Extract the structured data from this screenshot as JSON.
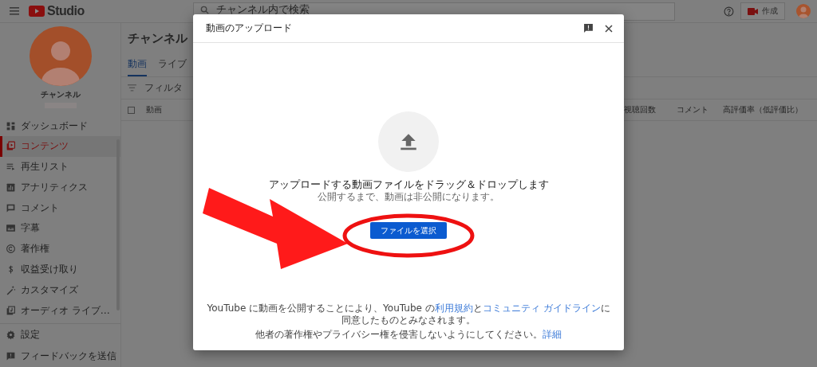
{
  "top_bar": {
    "logo_text": "Studio",
    "search": {
      "placeholder": "チャンネル内で検索"
    },
    "create_button": "作成"
  },
  "sidebar": {
    "channel_name": "チャンネル",
    "items": [
      {
        "label": "ダッシュボード",
        "selected": false
      },
      {
        "label": "コンテンツ",
        "selected": true
      },
      {
        "label": "再生リスト",
        "selected": false
      },
      {
        "label": "アナリティクス",
        "selected": false
      },
      {
        "label": "コメント",
        "selected": false
      },
      {
        "label": "字幕",
        "selected": false
      },
      {
        "label": "著作権",
        "selected": false
      },
      {
        "label": "収益受け取り",
        "selected": false
      },
      {
        "label": "カスタマイズ",
        "selected": false
      },
      {
        "label": "オーディオ ライブ…",
        "selected": false
      }
    ],
    "footer_items": [
      {
        "label": "設定",
        "selected": false
      },
      {
        "label": "フィードバックを送信",
        "selected": false
      }
    ]
  },
  "content": {
    "title": "チャンネル",
    "tabs": [
      {
        "label": "動画",
        "selected": true
      },
      {
        "label": "ライブ",
        "selected": false
      }
    ],
    "filter": "フィルタ",
    "select_all_checked": false,
    "columns": [
      "動画",
      "視聴回数",
      "コメント",
      "高評価率（低評価比）"
    ]
  },
  "dialog": {
    "title": "動画のアップロード",
    "message": "アップロードする動画ファイルをドラッグ＆ドロップします",
    "submessage": "公開するまで、動画は非公開になります。",
    "button": "ファイルを選択",
    "footer": [
      [
        {
          "text": "YouTube に動画を公開することにより、YouTube の",
          "link": false
        },
        {
          "text": "利用規約",
          "link": true
        },
        {
          "text": "と",
          "link": false
        },
        {
          "text": "コミュニティ ガイドライン",
          "link": true
        },
        {
          "text": "に同意したものとみなされます。",
          "link": false
        }
      ],
      [
        {
          "text": "他者の著作権やプライバシー権を侵害しないようにしてください。",
          "link": false
        },
        {
          "text": "詳細",
          "link": true
        }
      ]
    ]
  }
}
